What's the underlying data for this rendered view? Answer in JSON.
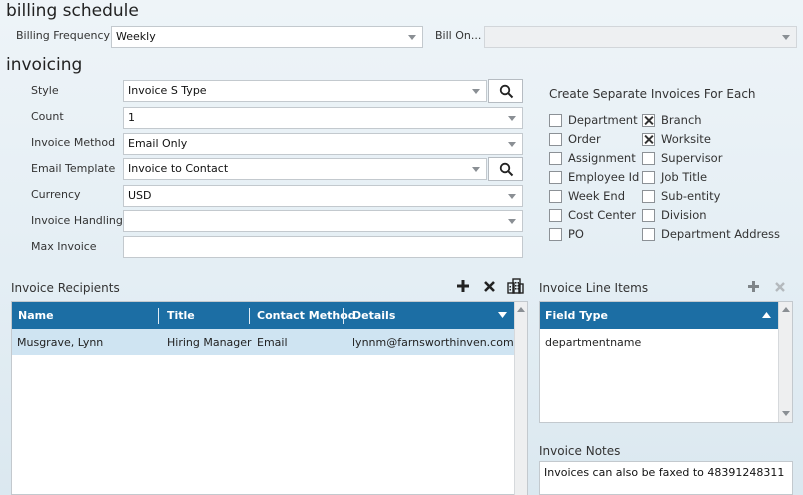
{
  "billing_schedule": {
    "title": "billing schedule",
    "frequency_label": "Billing Frequency",
    "frequency_value": "Weekly",
    "bill_on_label": "Bill On...",
    "bill_on_value": ""
  },
  "invoicing": {
    "title": "invoicing",
    "style_label": "Style",
    "style_value": "Invoice S Type",
    "count_label": "Count",
    "count_value": "1",
    "method_label": "Invoice Method",
    "method_value": "Email Only",
    "template_label": "Email Template",
    "template_value": "Invoice to Contact",
    "currency_label": "Currency",
    "currency_value": "USD",
    "handling_label": "Invoice Handling",
    "handling_value": "",
    "max_label": "Max Invoice",
    "max_value": ""
  },
  "separate_invoices": {
    "title": "Create Separate Invoices For Each",
    "left": [
      {
        "label": "Department",
        "checked": false
      },
      {
        "label": "Order",
        "checked": false
      },
      {
        "label": "Assignment",
        "checked": false
      },
      {
        "label": "Employee Id",
        "checked": false
      },
      {
        "label": "Week End",
        "checked": false
      },
      {
        "label": "Cost Center",
        "checked": false
      },
      {
        "label": "PO",
        "checked": false
      }
    ],
    "right": [
      {
        "label": "Branch",
        "checked": true
      },
      {
        "label": "Worksite",
        "checked": true
      },
      {
        "label": "Supervisor",
        "checked": false
      },
      {
        "label": "Job Title",
        "checked": false
      },
      {
        "label": "Sub-entity",
        "checked": false
      },
      {
        "label": "Division",
        "checked": false
      },
      {
        "label": "Department Address",
        "checked": false
      }
    ]
  },
  "recipients": {
    "title": "Invoice Recipients",
    "columns": {
      "name": "Name",
      "title": "Title",
      "method": "Contact Method",
      "details": "Details"
    },
    "rows": [
      {
        "name": "Musgrave, Lynn",
        "title": "Hiring Manager",
        "method": "Email",
        "details": "lynnm@farnsworthinven.com"
      }
    ]
  },
  "line_items": {
    "title": "Invoice Line Items",
    "column": "Field Type",
    "rows": [
      "departmentname"
    ]
  },
  "notes": {
    "title": "Invoice Notes",
    "text": "Invoices can also be faxed to 48391248311"
  },
  "colors": {
    "grid_header": "#1c6ea4",
    "selected_row": "#cfe4f2"
  }
}
